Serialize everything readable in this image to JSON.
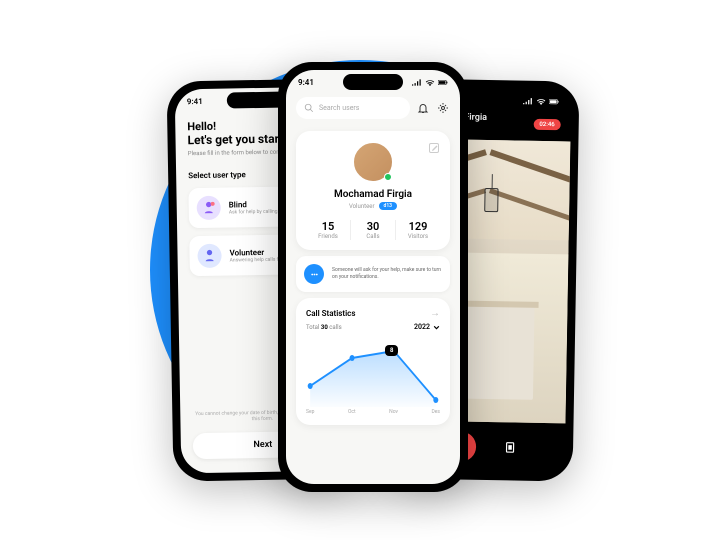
{
  "time": "9:41",
  "phone_left": {
    "greeting": "Hello!",
    "greeting2": "Let's get you started",
    "sub": "Please fill in the form below to continue.",
    "section": "Select user type",
    "blind": {
      "title": "Blind",
      "desc": "Ask for help by calling a vol"
    },
    "volunteer": {
      "title": "Volunteer",
      "desc": "Answering help calls from p"
    },
    "note": "You cannot change your date of birth, gender, an\nafter saving this form.",
    "next": "Next"
  },
  "phone_center": {
    "search_placeholder": "Search users",
    "name": "Mochamad Firgia",
    "role": "Volunteer",
    "badge": "d13",
    "stats": [
      {
        "val": "15",
        "label": "Friends"
      },
      {
        "val": "30",
        "label": "Calls"
      },
      {
        "val": "129",
        "label": "Visitors"
      }
    ],
    "tip": "Someone will ask for your help, make sure to turn on your notifications.",
    "chart_section_title": "Call Statistics",
    "chart_total_prefix": "Total ",
    "chart_total_value": "30",
    "chart_total_suffix": " calls",
    "year": "2022"
  },
  "phone_right": {
    "caller": "Mochamad Firgia",
    "timer": "02:46"
  },
  "chart_data": {
    "type": "area",
    "categories": [
      "Sep",
      "Oct",
      "Nov",
      "Des"
    ],
    "values": [
      3,
      7,
      8,
      1
    ],
    "highlight_index": 2,
    "highlight_value": 8,
    "title": "Call Statistics",
    "xlabel": "",
    "ylabel": "",
    "ylim": [
      0,
      10
    ],
    "year": "2022",
    "total": 30
  }
}
